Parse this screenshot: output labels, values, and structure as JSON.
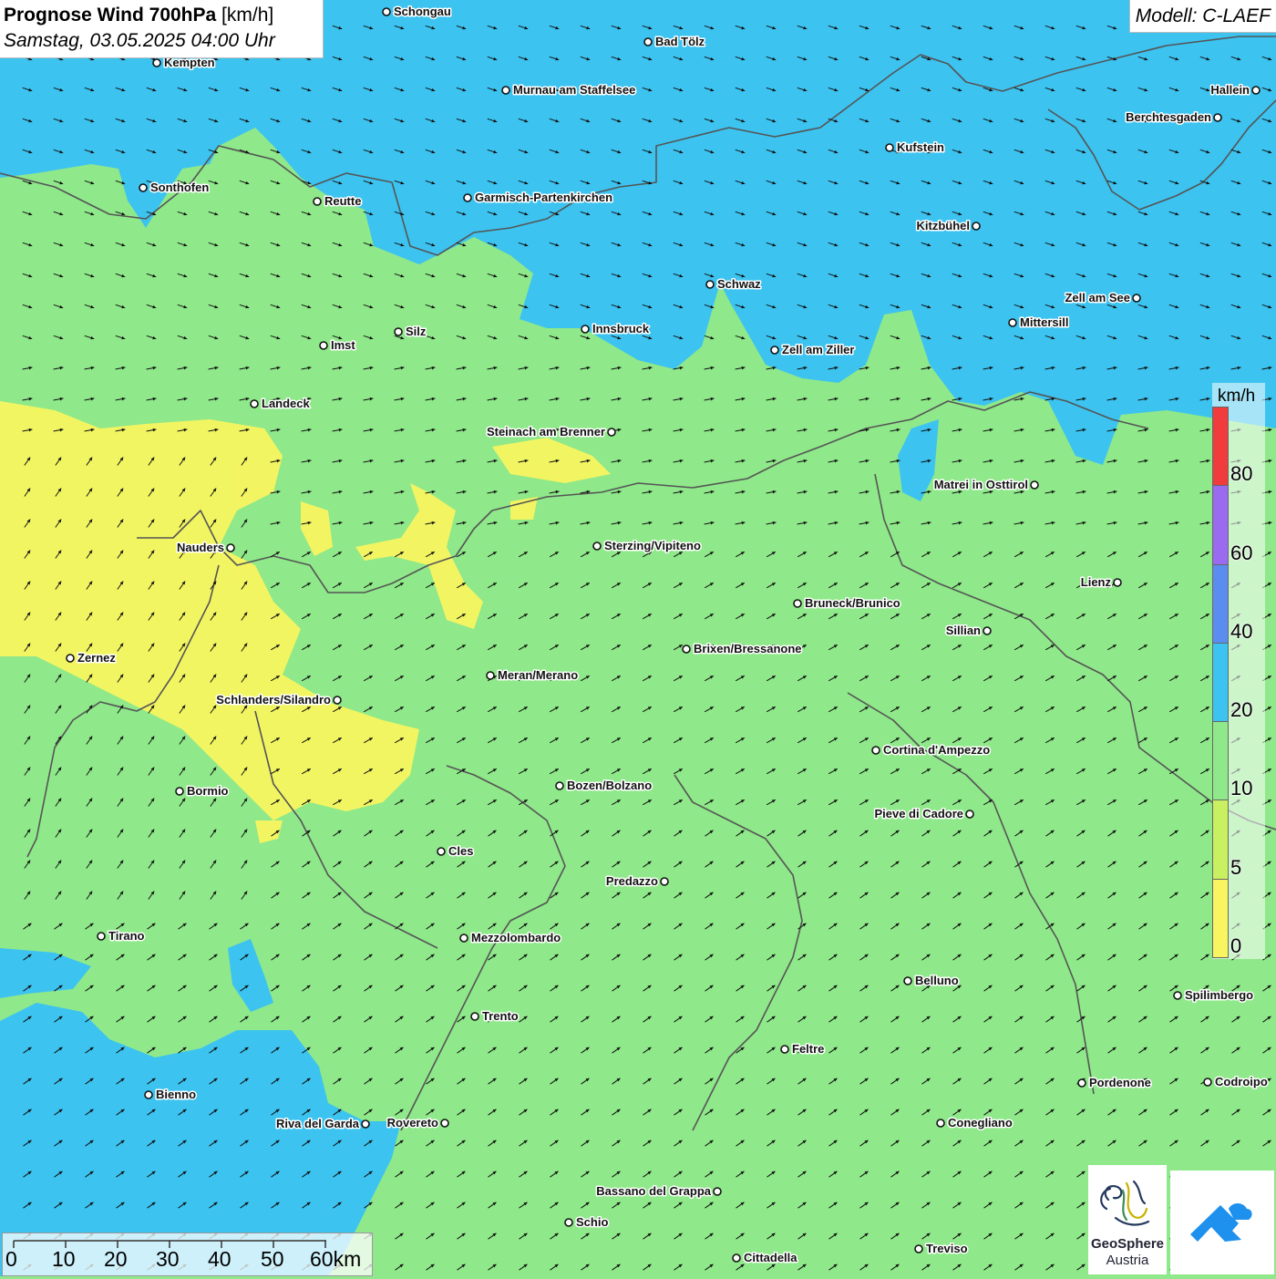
{
  "header": {
    "title_bold": "Prognose Wind 700hPa",
    "title_unit": "[km/h]",
    "datetime": "Samstag, 03.05.2025 04:00 Uhr",
    "model": "Modell: C-LAEF"
  },
  "legend": {
    "unit": "km/h",
    "bins": [
      {
        "color": "#f8f560",
        "from": 0,
        "to": 5
      },
      {
        "color": "#c9f060",
        "from": 5,
        "to": 10
      },
      {
        "color": "#8fe88a",
        "from": 10,
        "to": 20
      },
      {
        "color": "#3cc3f0",
        "from": 20,
        "to": 40
      },
      {
        "color": "#5b8df0",
        "from": 40,
        "to": 60
      },
      {
        "color": "#9a6af0",
        "from": 60,
        "to": 80
      },
      {
        "color": "#f03c3c",
        "from": 80,
        "to": 100
      }
    ],
    "labels": [
      "0",
      "5",
      "10",
      "20",
      "40",
      "60",
      "80"
    ]
  },
  "scalebar": {
    "labels": [
      "0",
      "10",
      "20",
      "30",
      "40",
      "50",
      "60km"
    ]
  },
  "logo": {
    "geosphere_line1": "GeoSphere",
    "geosphere_line2": "Austria"
  },
  "colors": {
    "calm": "#f8f560",
    "light": "#8fe88a",
    "moderate": "#3cc3f0",
    "border": "#555555"
  },
  "cities": [
    {
      "name": "Schongau"
    },
    {
      "name": "Bad Tölz"
    },
    {
      "name": "Kempten"
    },
    {
      "name": "Murnau am Staffelsee"
    },
    {
      "name": "Hallein"
    },
    {
      "name": "Berchtesgaden"
    },
    {
      "name": "Kufstein"
    },
    {
      "name": "Sonthofen"
    },
    {
      "name": "Reutte"
    },
    {
      "name": "Garmisch-Partenkirchen"
    },
    {
      "name": "Kitzbühel"
    },
    {
      "name": "Schwaz"
    },
    {
      "name": "Zell am See"
    },
    {
      "name": "Innsbruck"
    },
    {
      "name": "Mittersill"
    },
    {
      "name": "Silz"
    },
    {
      "name": "Imst"
    },
    {
      "name": "Zell am Ziller"
    },
    {
      "name": "Landeck"
    },
    {
      "name": "Steinach am Brenner"
    },
    {
      "name": "Matrei in Osttirol"
    },
    {
      "name": "Nauders"
    },
    {
      "name": "Sterzing/Vipiteno"
    },
    {
      "name": "Lienz"
    },
    {
      "name": "Bruneck/Brunico"
    },
    {
      "name": "Sillian"
    },
    {
      "name": "Brixen/Bressanone"
    },
    {
      "name": "Zernez"
    },
    {
      "name": "Meran/Merano"
    },
    {
      "name": "Schlanders/Silandro"
    },
    {
      "name": "Cortina d'Ampezzo"
    },
    {
      "name": "Bozen/Bolzano"
    },
    {
      "name": "Bormio"
    },
    {
      "name": "Pieve di Cadore"
    },
    {
      "name": "Cles"
    },
    {
      "name": "Predazzo"
    },
    {
      "name": "Tirano"
    },
    {
      "name": "Mezzolombardo"
    },
    {
      "name": "Belluno"
    },
    {
      "name": "Spilimbergo"
    },
    {
      "name": "Trento"
    },
    {
      "name": "Feltre"
    },
    {
      "name": "Bienno"
    },
    {
      "name": "Pordenone"
    },
    {
      "name": "Codroipo"
    },
    {
      "name": "Riva del Garda"
    },
    {
      "name": "Rovereto"
    },
    {
      "name": "Conegliano"
    },
    {
      "name": "Bassano del Grappa"
    },
    {
      "name": "Schio"
    },
    {
      "name": "Treviso"
    },
    {
      "name": "Cittadella"
    }
  ]
}
